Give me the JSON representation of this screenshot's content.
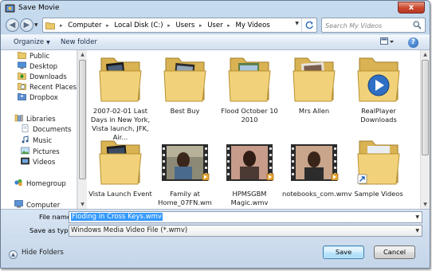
{
  "window": {
    "title": "Save Movie",
    "close_label": "x"
  },
  "address": {
    "crumbs": [
      "Computer",
      "Local Disk (C:)",
      "Users",
      "User",
      "My Videos"
    ]
  },
  "search": {
    "placeholder": "Search My Videos"
  },
  "toolbar": {
    "organize_label": "Organize",
    "new_folder_label": "New folder",
    "help_label": "?"
  },
  "nav": {
    "items": [
      {
        "label": "Public",
        "icon": "folder-icon"
      },
      {
        "label": "Desktop",
        "icon": "desktop-icon"
      },
      {
        "label": "Downloads",
        "icon": "downloads-icon"
      },
      {
        "label": "Recent Places",
        "icon": "recent-places-icon"
      },
      {
        "label": "Dropbox",
        "icon": "dropbox-icon"
      },
      {
        "label": "Libraries",
        "icon": "libraries-icon"
      },
      {
        "label": "Documents",
        "icon": "documents-icon"
      },
      {
        "label": "Music",
        "icon": "music-icon"
      },
      {
        "label": "Pictures",
        "icon": "pictures-icon"
      },
      {
        "label": "Videos",
        "icon": "videos-icon"
      },
      {
        "label": "Homegroup",
        "icon": "homegroup-icon"
      },
      {
        "label": "Computer",
        "icon": "computer-icon"
      }
    ]
  },
  "files": [
    {
      "name": "2007-02-01 Last Days in New York, Vista launch, JFK, Air...",
      "type": "folder",
      "icon": "photo-folder-icon"
    },
    {
      "name": "Best Buy",
      "type": "folder",
      "icon": "photo-folder-icon"
    },
    {
      "name": "Flood October 10 2010",
      "type": "folder",
      "icon": "photo-folder-icon"
    },
    {
      "name": "Mrs Allen",
      "type": "folder",
      "icon": "photo-folder-icon"
    },
    {
      "name": "RealPlayer Downloads",
      "type": "folder",
      "icon": "realplayer-folder-icon"
    },
    {
      "name": "Vista Launch Event",
      "type": "folder",
      "icon": "photo-folder-icon"
    },
    {
      "name": "Family at Home_07FN.wm",
      "type": "video",
      "icon": "video-thumbnail-icon"
    },
    {
      "name": "HPMSGBM Magic.wmv",
      "type": "video",
      "icon": "video-thumbnail-icon"
    },
    {
      "name": "notebooks_com.wmv",
      "type": "video",
      "icon": "video-thumbnail-icon"
    },
    {
      "name": "Sample Videos",
      "type": "shortcut-folder",
      "icon": "shortcut-folder-icon"
    }
  ],
  "form": {
    "filename_label": "File name:",
    "filename_value": "Floding in Cross Keys.wmv",
    "savetype_label": "Save as type:",
    "savetype_value": "Windows Media Video File (*.wmv)"
  },
  "footer": {
    "hide_folders_label": "Hide Folders",
    "save_label": "Save",
    "cancel_label": "Cancel"
  }
}
